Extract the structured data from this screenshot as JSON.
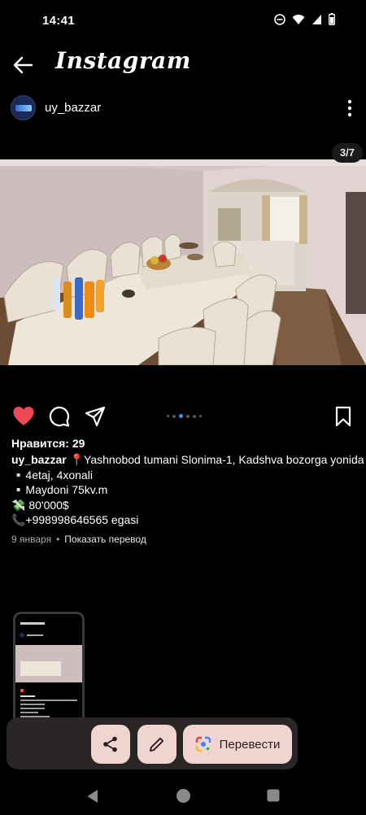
{
  "status": {
    "time": "14:41"
  },
  "app": {
    "title": "Instagram"
  },
  "post": {
    "username": "uy_bazzar",
    "counter": "3/7",
    "likes": "Нравится: 29",
    "caption": {
      "user": "uy_bazzar",
      "lines": [
        "📍Yashnobod tumani Slonima-1, Kadshva bozorga yonida",
        "▫️4etaj, 4xonali",
        "▫️Maydoni 75kv.m",
        "💸 80'000$",
        "📞+998998646565 egasi"
      ]
    },
    "date": "9 января",
    "translate_link": "Показать перевод"
  },
  "toolbar": {
    "translate_label": "Перевести"
  },
  "colors": {
    "like": "#ed4956",
    "chip": "#f0d4cf",
    "active_dot": "#3897f0"
  },
  "icons": [
    "back-arrow-icon",
    "more-vertical-icon",
    "heart-icon",
    "comment-icon",
    "send-icon",
    "bookmark-icon",
    "share-icon",
    "edit-icon",
    "google-lens-icon"
  ]
}
